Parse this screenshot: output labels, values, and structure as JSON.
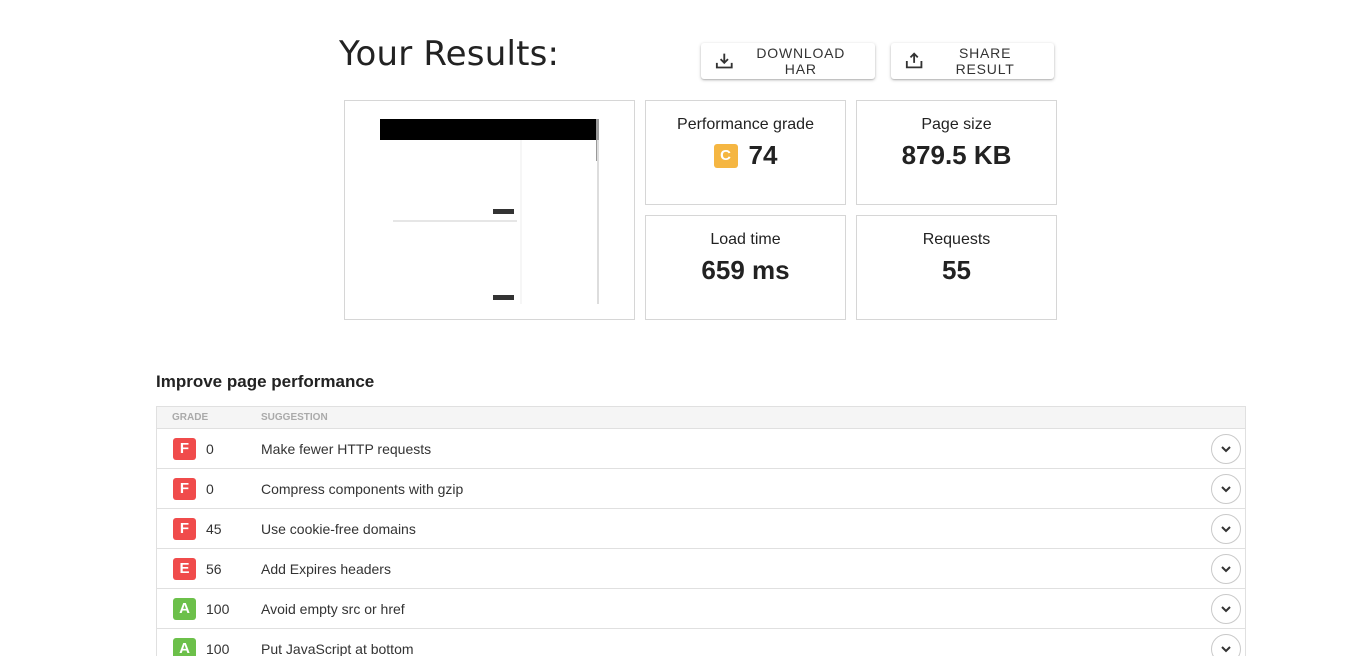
{
  "header": {
    "title": "Your Results:",
    "download_label": "DOWNLOAD HAR",
    "share_label": "SHARE RESULT"
  },
  "metrics": {
    "performance": {
      "label": "Performance grade",
      "grade": "C",
      "value": "74",
      "grade_color": "#f5b642"
    },
    "page_size": {
      "label": "Page size",
      "value": "879.5 KB"
    },
    "load_time": {
      "label": "Load time",
      "value": "659 ms"
    },
    "requests": {
      "label": "Requests",
      "value": "55"
    }
  },
  "improve": {
    "title": "Improve page performance",
    "col_grade": "GRADE",
    "col_suggestion": "SUGGESTION",
    "rows": [
      {
        "grade": "F",
        "score": "0",
        "suggestion": "Make fewer HTTP requests",
        "color": "#f04b4b"
      },
      {
        "grade": "F",
        "score": "0",
        "suggestion": "Compress components with gzip",
        "color": "#f04b4b"
      },
      {
        "grade": "F",
        "score": "45",
        "suggestion": "Use cookie-free domains",
        "color": "#f04b4b"
      },
      {
        "grade": "E",
        "score": "56",
        "suggestion": "Add Expires headers",
        "color": "#f04b4b"
      },
      {
        "grade": "A",
        "score": "100",
        "suggestion": "Avoid empty src or href",
        "color": "#6cc04a"
      },
      {
        "grade": "A",
        "score": "100",
        "suggestion": "Put JavaScript at bottom",
        "color": "#6cc04a"
      }
    ]
  }
}
